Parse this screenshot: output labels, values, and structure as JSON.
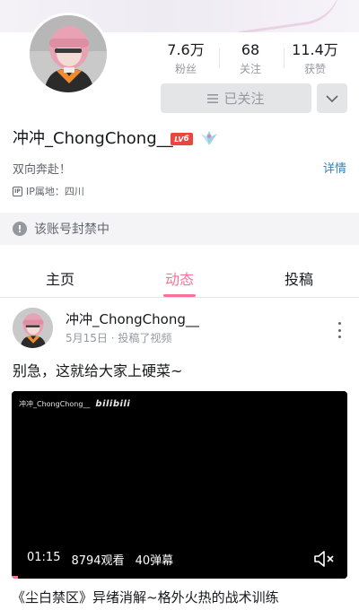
{
  "profile": {
    "username": "冲冲_ChongChong__",
    "level_badge": "6",
    "level_prefix": "LV",
    "signature": "双向奔赴！",
    "detail_link": "详情",
    "ip_tag": "IP",
    "ip_location": "IP属地：四川"
  },
  "stats": [
    {
      "value": "7.6万",
      "label": "粉丝"
    },
    {
      "value": "68",
      "label": "关注"
    },
    {
      "value": "11.4万",
      "label": "获赞"
    }
  ],
  "actions": {
    "followed_label": "已关注",
    "followed_icon": "menu-lines-icon",
    "more_icon": "chevron-down-icon"
  },
  "notice": {
    "banned_text": "该账号封禁中",
    "icon": "warning-icon"
  },
  "tabs": [
    {
      "label": "主页",
      "active": false
    },
    {
      "label": "动态",
      "active": true
    },
    {
      "label": "投稿",
      "active": false
    }
  ],
  "post": {
    "author": "冲冲_ChongChong__",
    "meta": "5月15日 · 投稿了视频",
    "text": "别急，这就给大家上硬菜~",
    "video": {
      "watermark_user": "冲冲_ChongChong__",
      "watermark_brand": "bilibili",
      "duration": "01:15",
      "views": "8794观看",
      "danmaku": "40弹幕",
      "progress": 0.02
    },
    "video_title": "《尘白禁区》异绪消解~格外火热的战术训练"
  },
  "colors": {
    "accent": "#fb7299",
    "link": "#2f82b8",
    "level_badge": "#e8473e"
  }
}
